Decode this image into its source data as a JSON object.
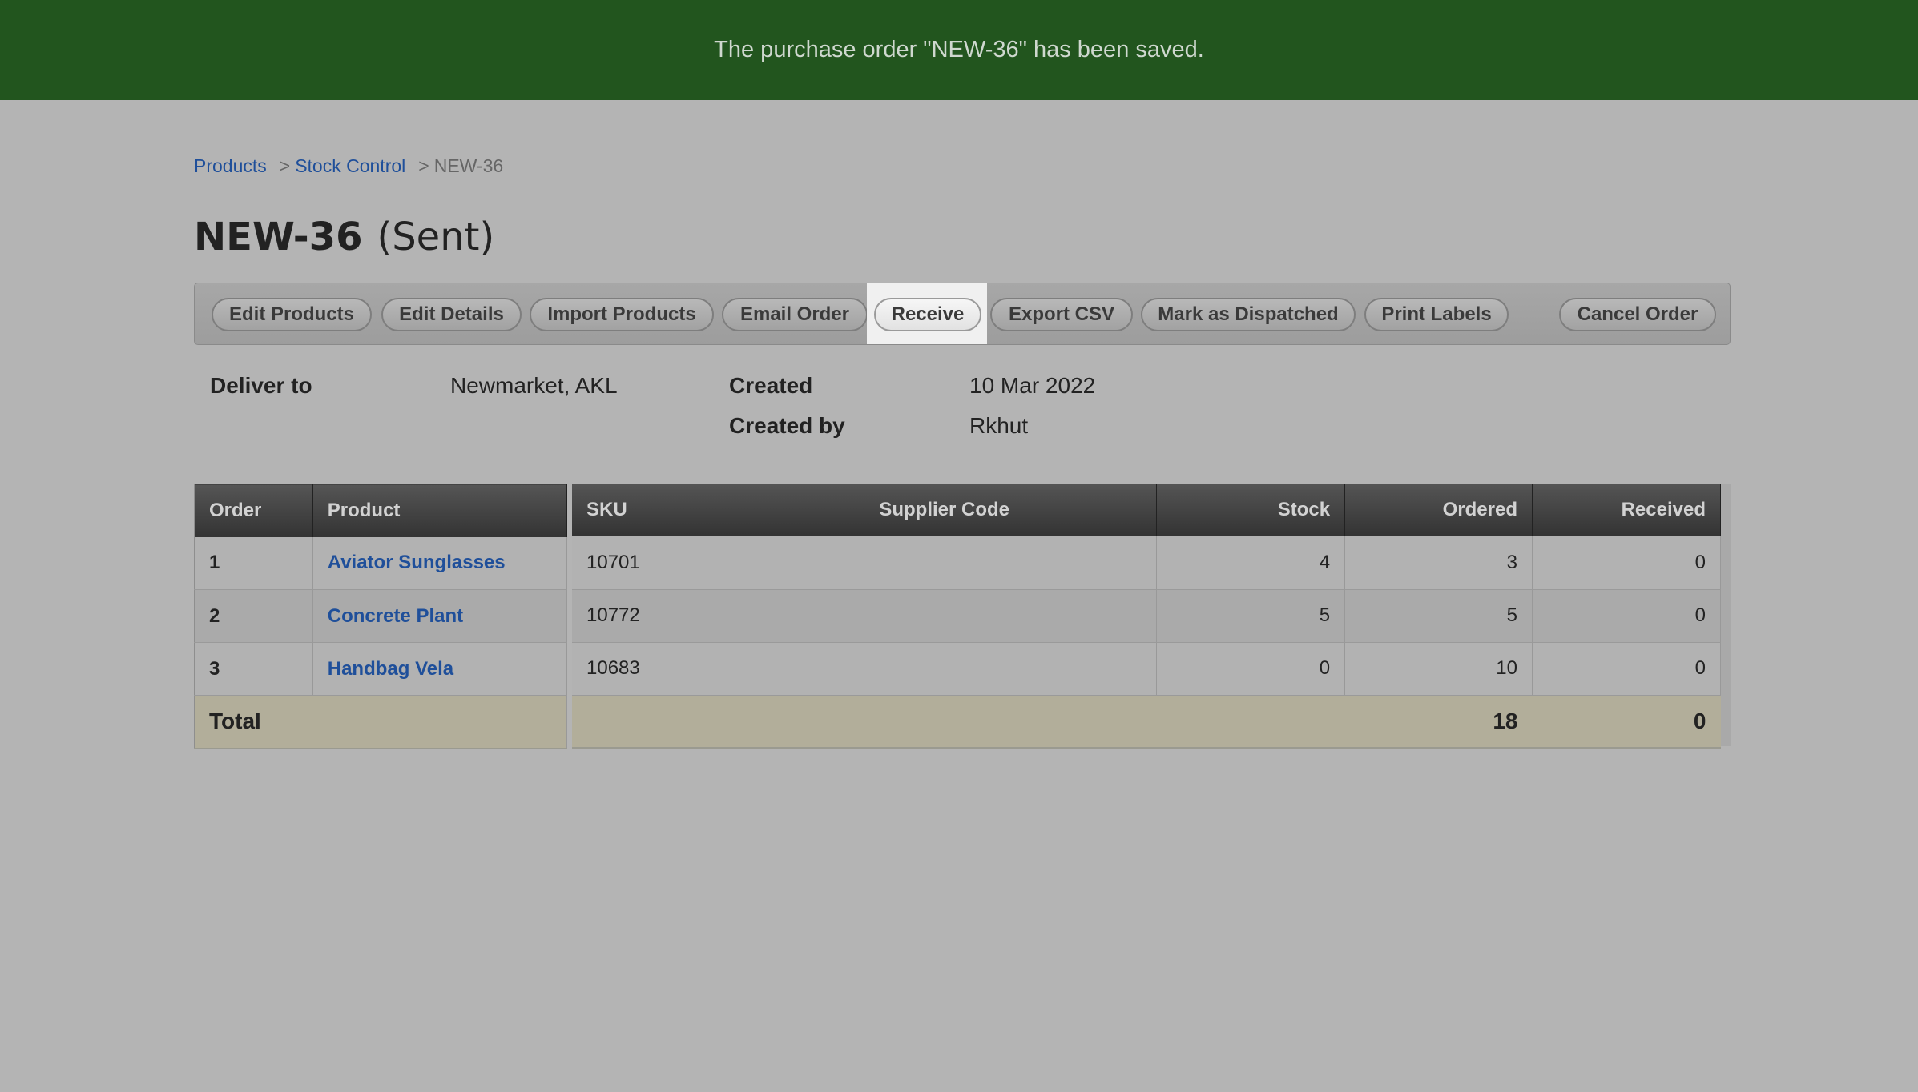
{
  "banner": {
    "message": "The purchase order \"NEW-36\" has been saved."
  },
  "breadcrumb": {
    "items": [
      {
        "label": "Products"
      },
      {
        "label": "Stock Control"
      }
    ],
    "separator": ">",
    "current": "NEW-36"
  },
  "page": {
    "title": "NEW-36",
    "status": "(Sent)"
  },
  "toolbar": {
    "buttons": [
      {
        "label": "Edit Products"
      },
      {
        "label": "Edit Details"
      },
      {
        "label": "Import Products"
      },
      {
        "label": "Email Order"
      },
      {
        "label": "Receive",
        "active": true
      },
      {
        "label": "Export CSV"
      },
      {
        "label": "Mark as Dispatched"
      },
      {
        "label": "Print Labels"
      },
      {
        "label": "Cancel Order"
      }
    ]
  },
  "details": {
    "deliver_to_label": "Deliver to",
    "deliver_to_value": "Newmarket, AKL",
    "created_label": "Created",
    "created_value": "10 Mar 2022",
    "created_by_label": "Created by",
    "created_by_value": "Rkhut"
  },
  "table": {
    "columns": {
      "order": "Order",
      "product": "Product",
      "sku": "SKU",
      "supplier_code": "Supplier Code",
      "stock": "Stock",
      "ordered": "Ordered",
      "received": "Received"
    },
    "rows": [
      {
        "order": "1",
        "product": "Aviator Sunglasses",
        "sku": "10701",
        "supplier_code": "",
        "stock": "4",
        "ordered": "3",
        "received": "0"
      },
      {
        "order": "2",
        "product": "Concrete Plant",
        "sku": "10772",
        "supplier_code": "",
        "stock": "5",
        "ordered": "5",
        "received": "0"
      },
      {
        "order": "3",
        "product": "Handbag Vela",
        "sku": "10683",
        "supplier_code": "",
        "stock": "0",
        "ordered": "10",
        "received": "0"
      }
    ],
    "total": {
      "label": "Total",
      "ordered": "18",
      "received": "0"
    }
  },
  "colors": {
    "banner": "#22551e",
    "link": "#1f4f9a",
    "background": "#b4b4b4",
    "total_row": "#b2ae9a"
  }
}
